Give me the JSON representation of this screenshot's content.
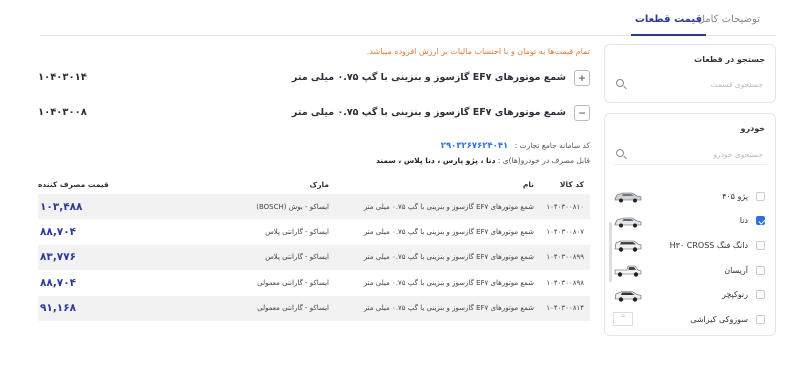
{
  "tabs": {
    "description": "توضیحات کامل",
    "prices": "قیمت قطعات"
  },
  "sidebar": {
    "parts_search": {
      "title": "جستجو در قطعات",
      "placeholder": "جستجوی قسمت"
    },
    "cars": {
      "title": "خودرو",
      "placeholder": "جستجوی خودرو",
      "items": [
        {
          "label": "پژو ۴۰۵",
          "checked": false,
          "icon": "sedan-icon"
        },
        {
          "label": "دنا",
          "checked": true,
          "icon": "sedan-icon"
        },
        {
          "label": "دانگ فنگ H۳۰ CROSS",
          "checked": false,
          "icon": "suv-icon"
        },
        {
          "label": "آریسان",
          "checked": false,
          "icon": "pickup-icon"
        },
        {
          "label": "رنوکپچر",
          "checked": false,
          "icon": "suv-icon"
        },
        {
          "label": "سوزوکی کیزاشی",
          "checked": false,
          "icon": "broken-image-icon"
        }
      ]
    }
  },
  "main": {
    "notice": "تمام قیمت‌ها به تومان و با احتساب مالیات بر ارزش افزوده میباشد.",
    "products": [
      {
        "toggle": "+",
        "title": "شمع موتورهای EF۷ گازسوز و بنزینی با گپ ۰.۷۵ میلی متر",
        "code": "۱۰۴۰۳۰۱۴"
      },
      {
        "toggle": "−",
        "title": "شمع موتورهای EF۷ گازسوز و بنزینی با گپ ۰.۷۵ میلی متر",
        "code": "۱۰۴۰۳۰۰۸"
      }
    ],
    "commerce_label": "کد سامانه جامع تجارت :",
    "commerce_code": "۲۹۰۳۲۶۷۶۲۴۰۴۱",
    "usable_label": "قابل مصرف در خودرو(ها)ی :",
    "usable_cars": "دنا ، پژو پارس ، دنا پلاس ، سمند",
    "table": {
      "headers": {
        "code": "کد کالا",
        "name": "نام",
        "brand": "مارک",
        "price": "قیمت مصرف کننده"
      },
      "rows": [
        {
          "code": "۱۰۴۰۳۰۰۸۱۰",
          "name": "شمع موتورهای EF۷ گازسوز و بنزینی با گپ ۰.۷۵ میلی متر",
          "brand": "ایساکو - بوش (BOSCH)",
          "price": "۱۰۳,۴۸۸"
        },
        {
          "code": "۱۰۴۰۳۰۰۸۰۷",
          "name": "شمع موتورهای EF۷ گازسوز و بنزینی با گپ ۰.۷۵ میلی متر",
          "brand": "ایساکو - گارانتی پلاس",
          "price": "۸۸,۷۰۴"
        },
        {
          "code": "۱۰۴۰۳۰۰۸۹۹",
          "name": "شمع موتورهای EF۷ گازسوز و بنزینی با گپ ۰.۷۵ میلی متر",
          "brand": "ایساکو - گارانتی پلاس",
          "price": "۸۳,۷۷۶"
        },
        {
          "code": "۱۰۴۰۳۰۰۸۹۸",
          "name": "شمع موتورهای EF۷ گازسوز و بنزینی با گپ ۰.۷۵ میلی متر",
          "brand": "ایساکو - گارانتی معمولی",
          "price": "۸۸,۷۰۴"
        },
        {
          "code": "۱۰۴۰۳۰۰۸۱۴",
          "name": "شمع موتورهای EF۷ گازسوز و بنزینی با گپ ۰.۷۵ میلی متر",
          "brand": "ایساکو - گارانتی معمولی",
          "price": "۹۱,۱۶۸"
        }
      ]
    }
  },
  "colors": {
    "accent": "#2b3a8c",
    "notice": "#e07a3b",
    "link": "#2f6fe0",
    "checkbox": "#2f6fe0"
  }
}
